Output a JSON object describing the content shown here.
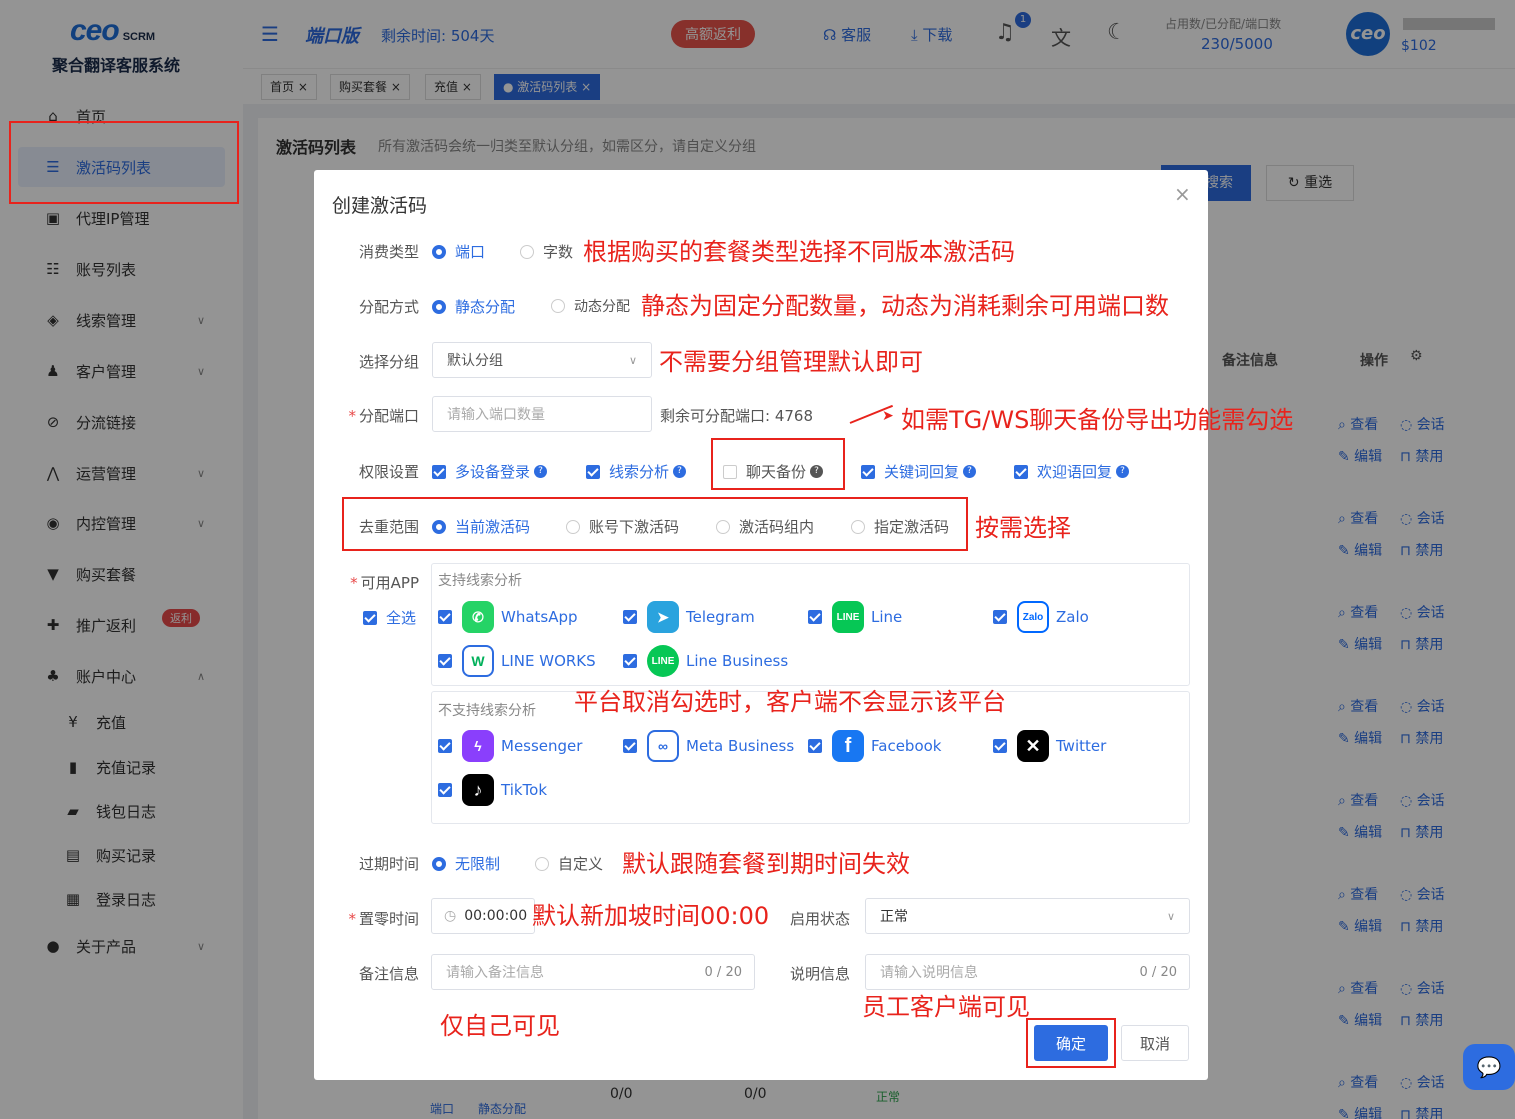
{
  "app": {
    "logo": "ceo",
    "logo_sub": "SCRM",
    "brand": "聚合翻译客服系统"
  },
  "sidebar": {
    "items": [
      {
        "label": "首页",
        "icon": "home-icon"
      },
      {
        "label": "激活码列表",
        "icon": "list-icon"
      },
      {
        "label": "代理IP管理",
        "icon": "ip-icon"
      },
      {
        "label": "账号列表",
        "icon": "account-list-icon"
      },
      {
        "label": "线索管理",
        "icon": "clue-icon"
      },
      {
        "label": "客户管理",
        "icon": "customer-icon"
      },
      {
        "label": "分流链接",
        "icon": "link-icon"
      },
      {
        "label": "运营管理",
        "icon": "operation-icon"
      },
      {
        "label": "内控管理",
        "icon": "control-icon"
      },
      {
        "label": "购买套餐",
        "icon": "package-icon"
      },
      {
        "label": "推广返利",
        "icon": "gift-icon",
        "badge": "返利"
      },
      {
        "label": "账户中心",
        "icon": "account-center-icon"
      },
      {
        "label": "充值",
        "icon": "yen-icon"
      },
      {
        "label": "充值记录",
        "icon": "record-icon"
      },
      {
        "label": "钱包日志",
        "icon": "wallet-icon"
      },
      {
        "label": "购买记录",
        "icon": "purchase-icon"
      },
      {
        "label": "登录日志",
        "icon": "login-log-icon"
      },
      {
        "label": "关于产品",
        "icon": "info-icon"
      }
    ]
  },
  "header": {
    "title": "端口版",
    "remaining": "剩余时间: 504天",
    "promo": "高额返利",
    "service": "客服",
    "download": "下载",
    "bell_count": "1",
    "stats_label": "占用数/已分配/端口数",
    "stats_value": "230/5000",
    "avatar": "ceo",
    "balance": "$102"
  },
  "tabs": [
    {
      "label": "首页 ×"
    },
    {
      "label": "购买套餐 ×"
    },
    {
      "label": "充值 ×"
    },
    {
      "label": "● 激活码列表 ×"
    }
  ],
  "content": {
    "title": "激活码列表",
    "desc": "所有激活码会统一归类至默认分组，如需区分，请自定义分组",
    "search": "搜索",
    "reset": "重选",
    "col_remark": "备注信息",
    "col_ops": "操作",
    "op_view": "查看",
    "op_chat": "会话",
    "op_edit": "编辑",
    "op_disable": "禁用",
    "row_vals": [
      "0/0",
      "0/0",
      "正常",
      "端口",
      "静态分配"
    ]
  },
  "dialog": {
    "title": "创建激活码",
    "consume": {
      "label": "消费类型",
      "opt1": "端口",
      "opt2": "字数"
    },
    "alloc": {
      "label": "分配方式",
      "opt1": "静态分配",
      "opt2": "动态分配"
    },
    "group": {
      "label": "选择分组",
      "value": "默认分组"
    },
    "port": {
      "label": "分配端口",
      "placeholder": "请输入端口数量",
      "remaining": "剩余可分配端口: 4768"
    },
    "perm": {
      "label": "权限设置",
      "items": [
        "多设备登录",
        "线索分析",
        "聊天备份",
        "关键词回复",
        "欢迎语回复"
      ]
    },
    "dedup": {
      "label": "去重范围",
      "opts": [
        "当前激活码",
        "账号下激活码",
        "激活码组内",
        "指定激活码"
      ]
    },
    "apps": {
      "label": "可用APP",
      "select_all": "全选",
      "supported_title": "支持线索分析",
      "unsupported_title": "不支持线索分析",
      "supported": [
        "WhatsApp",
        "Telegram",
        "Line",
        "Zalo",
        "LINE WORKS",
        "Line Business"
      ],
      "unsupported": [
        "Messenger",
        "Meta Business",
        "Facebook",
        "Twitter",
        "TikTok"
      ]
    },
    "expire": {
      "label": "过期时间",
      "opt1": "无限制",
      "opt2": "自定义"
    },
    "reset_time": {
      "label": "置零时间",
      "value": "00:00:00"
    },
    "status": {
      "label": "启用状态",
      "value": "正常"
    },
    "remark": {
      "label": "备注信息",
      "placeholder": "请输入备注信息",
      "count": "0 / 20"
    },
    "explain": {
      "label": "说明信息",
      "placeholder": "请输入说明信息",
      "count": "0 / 20"
    },
    "confirm": "确定",
    "cancel": "取消"
  },
  "annotations": {
    "consume": "根据购买的套餐类型选择不同版本激活码",
    "alloc": "静态为固定分配数量，动态为消耗剩余可用端口数",
    "group": "不需要分组管理默认即可",
    "backup": "如需TG/WS聊天备份导出功能需勾选",
    "dedup": "按需选择",
    "apps": "平台取消勾选时，客户端不会显示该平台",
    "expire": "默认跟随套餐到期时间失效",
    "reset": "默认新加坡时间00:00",
    "remark": "仅自己可见",
    "explain": "员工客户端可见"
  },
  "colors": {
    "primary": "#2d6ce0",
    "annotation": "#e8231c"
  }
}
